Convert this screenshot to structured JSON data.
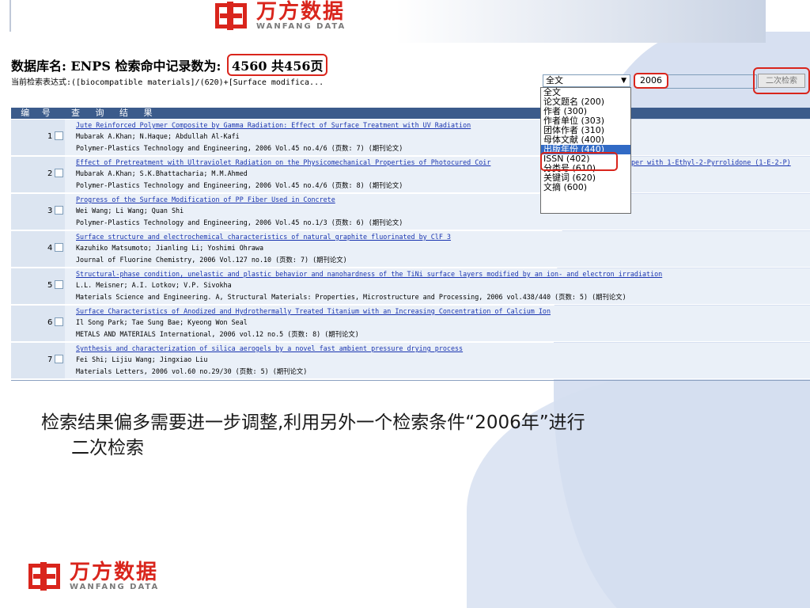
{
  "brand": {
    "name_cn": "万方数据",
    "name_en": "WANFANG DATA",
    "accent": "#d9251c"
  },
  "header": {
    "title_prefix": "数据库名: ENPS 检索命中记录数为:",
    "title_count": "4560 共456页",
    "expression": "当前检索表达式:([biocompatible materials]/(620)+[Surface modifica..."
  },
  "search": {
    "field_select": "全文",
    "keyword": "2006",
    "secondary_button": "二次检索"
  },
  "dropdown": {
    "items": [
      "全文",
      "论文题名 (200)",
      "作者 (300)",
      "作者单位 (303)",
      "团体作者 (310)",
      "母体文献 (400)",
      "出版年份 (440)",
      "ISSN (402)",
      "分类号 (610)",
      "关键词 (620)",
      "文摘 (600)"
    ],
    "highlighted_item": "出版年份 (440)"
  },
  "table": {
    "col_number": "编 号",
    "col_result": "查 询 结 果",
    "overflow_title_text": "per with 1-Ethyl-2-Pyrrolidone (1-E-2-P)",
    "rows": [
      {
        "no": "1",
        "title": "Jute Reinforced Polymer Composite by Gamma Radiation: Effect of Surface Treatment with UV Radiation",
        "authors": "Mubarak A.Khan; N.Haque; Abdullah Al-Kafi",
        "source": "Polymer-Plastics Technology and Engineering, 2006 Vol.45 no.4/6 (页数: 7) (期刊论文)"
      },
      {
        "no": "2",
        "title": "Effect of Pretreatment with Ultraviolet Radiation on the Physicomechanical Properties of Photocured Coir",
        "authors": "Mubarak A.Khan; S.K.Bhattacharia; M.M.Ahmed",
        "source": "Polymer-Plastics Technology and Engineering, 2006 Vol.45 no.4/6 (页数: 8) (期刊论文)"
      },
      {
        "no": "3",
        "title": "Progress of the Surface Modification of PP Fiber Used in Concrete",
        "authors": "Wei Wang; Li Wang; Quan Shi",
        "source": "Polymer-Plastics Technology and Engineering, 2006 Vol.45 no.1/3 (页数: 6) (期刊论文)"
      },
      {
        "no": "4",
        "title": "Surface structure and electrochemical characteristics of natural graphite fluorinated by ClF_3",
        "authors": "Kazuhiko Matsumoto; Jianling Li; Yoshimi Ohrawa",
        "source": "Journal of Fluorine Chemistry, 2006 Vol.127 no.10 (页数: 7) (期刊论文)"
      },
      {
        "no": "5",
        "title": "Structural-phase condition, unelastic and plastic behavior and nanohardness of the TiNi surface layers modified by an ion- and electron irradiation",
        "authors": "L.L. Meisner; A.I. Lotkov; V.P. Sivokha",
        "source": "Materials Science and Engineering. A, Structural Materials: Properties, Microstructure and Processing, 2006 vol.438/440 (页数: 5) (期刊论文)"
      },
      {
        "no": "6",
        "title": "Surface Characteristics of Anodized and Hydrothermally Treated Titanium with an Increasing Concentration of Calcium Ion",
        "authors": "Il Song Park; Tae Sung Bae; Kyeong Won Seal",
        "source": "METALS AND MATERIALS International, 2006 vol.12 no.5 (页数: 8) (期刊论文)"
      },
      {
        "no": "7",
        "title": "Synthesis and characterization of silica aerogels by a novel fast ambient pressure drying process",
        "authors": "Fei Shi; Lijiu Wang; Jingxiao Liu",
        "source": "Materials Letters, 2006 vol.60 no.29/30 (页数: 5) (期刊论文)"
      }
    ]
  },
  "caption": {
    "line1": "检索结果偏多需要进一步调整,利用另外一个检索条件“2006年”进行",
    "line2": "二次检索"
  }
}
